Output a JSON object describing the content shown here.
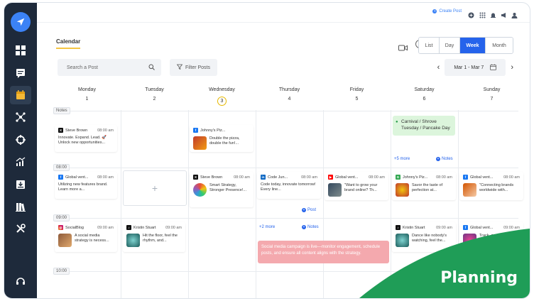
{
  "topbar": {
    "create_post": "Create Post"
  },
  "calendar": {
    "title": "Calendar",
    "views": [
      "List",
      "Day",
      "Week",
      "Month"
    ],
    "active_view": "Week",
    "search_placeholder": "Search a Post",
    "filter_label": "Filter Posts",
    "date_range": "Mar 1 - Mar 7"
  },
  "days": [
    {
      "name": "Monday",
      "num": "1"
    },
    {
      "name": "Tuesday",
      "num": "2"
    },
    {
      "name": "Wednesday",
      "num": "3"
    },
    {
      "name": "Thursday",
      "num": "4"
    },
    {
      "name": "Friday",
      "num": "5"
    },
    {
      "name": "Saturday",
      "num": "6"
    },
    {
      "name": "Sunday",
      "num": "7"
    }
  ],
  "time_labels": [
    "Notes",
    "08:00",
    "09:00",
    "10:00"
  ],
  "posts": {
    "mon_notes": {
      "name": "Steve Brown",
      "time": "08:00 am",
      "text": "Innovate. Expand. Lead. 🚀 Unlock new opportunities..."
    },
    "wed_notes": {
      "name": "Johnny's Piz...",
      "time": "08:00 am",
      "text": "Double the pizza, double the fun!..."
    },
    "mon_8": {
      "name": "Global vent...",
      "time": "08:00 am",
      "text": "Utilizing new features brand. Learn more a..."
    },
    "wed_8": {
      "name": "Steve Brown",
      "time": "08:00 am",
      "text": "Smart Strategy, Stronger Presence!..."
    },
    "thu_8": {
      "name": "Code Jun...",
      "time": "08:00 am",
      "text": "Code today, innovate tomorrow! Every line..."
    },
    "fri_8": {
      "name": "Global vent...",
      "time": "08:00 am",
      "text": "\"Want to grow your brand online? Th..."
    },
    "sat_8": {
      "name": "Johnny's Piz...",
      "time": "08:00 am",
      "text": "Savor the taste of perfection at..."
    },
    "sun_8": {
      "name": "Global vent...",
      "time": "08:00 am",
      "text": "\"Connecting brands worldwide with..."
    },
    "mon_9": {
      "name": "SocialBlog",
      "time": "09:00 am",
      "text": "A social media strategy is necess..."
    },
    "tue_9": {
      "name": "Kristin Stuart",
      "time": "09:00 am",
      "text": "Hit the floor, feel the rhythm, and..."
    },
    "sat_9": {
      "name": "Kristin Stuart",
      "time": "09:00 am",
      "text": "Dance like nobody's watching, feel the..."
    },
    "sun_9": {
      "name": "Global vent...",
      "time": "09:00 am",
      "text": "Track, analyze, and optimize with our..."
    }
  },
  "event": {
    "text": "Carnival / Shrove Tuesday / Pancake Day"
  },
  "links": {
    "more_sat": "+5 more",
    "notes": "Notes",
    "post": "Post",
    "more_thu": "+2 more"
  },
  "campaign": {
    "text": "Social media campaign is live—monitor engagement, schedule posts, and ensure all content aligns with the strategy."
  },
  "banner": {
    "text": "Planning"
  },
  "colors": {
    "sidebar": "#1e2a3b",
    "accent": "#2563eb",
    "event": "#dcf5dc",
    "campaign": "#f4a9ae",
    "planning": "#1f9d57"
  }
}
